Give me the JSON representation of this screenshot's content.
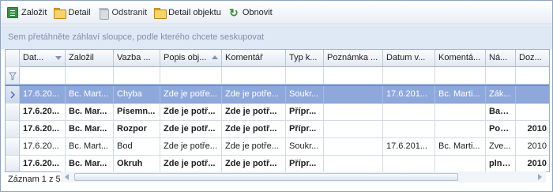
{
  "toolbar": {
    "items": [
      {
        "label": "Založit",
        "icon": "new-record-icon"
      },
      {
        "label": "Detail",
        "icon": "folder-icon"
      },
      {
        "label": "Odstranit",
        "icon": "trash-icon"
      },
      {
        "label": "Detail objektu",
        "icon": "folder-icon"
      },
      {
        "label": "Obnovit",
        "icon": "refresh-icon"
      }
    ]
  },
  "group_panel": {
    "text": "Sem přetáhněte záhlaví sloupce, podle kterého chcete seskupovat"
  },
  "grid": {
    "columns": [
      {
        "label": "Dat...",
        "sort": "desc"
      },
      {
        "label": "Založil",
        "sort": ""
      },
      {
        "label": "Vazba ...",
        "sort": ""
      },
      {
        "label": "Popis obj...",
        "sort": "asc"
      },
      {
        "label": "Komentář",
        "sort": ""
      },
      {
        "label": "Typ k...",
        "sort": ""
      },
      {
        "label": "Poznámka ...",
        "sort": ""
      },
      {
        "label": "Datum v...",
        "sort": ""
      },
      {
        "label": "Komentá...",
        "sort": ""
      },
      {
        "label": "Ná...",
        "sort": ""
      },
      {
        "label": "Doz...",
        "sort": ""
      }
    ],
    "rows": [
      {
        "bold": false,
        "selected": true,
        "cells": [
          "17.6.20...",
          "Bc. Mart...",
          "Chyba",
          "Zde je potře...",
          "Zde je potře...",
          "Soukr...",
          "",
          "17.6.201...",
          "Bc. Marti...",
          "Zák...",
          ""
        ]
      },
      {
        "bold": true,
        "selected": false,
        "cells": [
          "17.6.20...",
          "Bc. Mar...",
          "Písemn...",
          "Zde je potř...",
          "Zde je potř...",
          "Přípr...",
          "",
          "",
          "",
          "Ban...",
          ""
        ]
      },
      {
        "bold": true,
        "selected": false,
        "cells": [
          "17.6.20...",
          "Bc. Mar...",
          "Rozpor",
          "Zde je potř...",
          "Zde je potř...",
          "Přípr...",
          "",
          "",
          "",
          "Poc...",
          "2010"
        ]
      },
      {
        "bold": false,
        "selected": false,
        "cells": [
          "17.6.20...",
          "Bc. Mart...",
          "Bod",
          "Zde je potře...",
          "Zde je potře...",
          "Soukr...",
          "",
          "17.6.201...",
          "Bc. Marti...",
          "Zve...",
          "2010"
        ]
      },
      {
        "bold": true,
        "selected": false,
        "cells": [
          "17.6.20...",
          "Bc. Mar...",
          "Okruh",
          "Zde je potř...",
          "Zde je potř...",
          "Přípr...",
          "",
          "",
          "",
          "plně...",
          "2010"
        ]
      }
    ]
  },
  "status": {
    "text": "Záznam 1 z 5"
  },
  "colors": {
    "selected_row": "#8fa8dc",
    "group_panel_bg": "#dfe8f5",
    "group_panel_text": "#7f90aa",
    "refresh_icon": "#3f8a3f"
  }
}
